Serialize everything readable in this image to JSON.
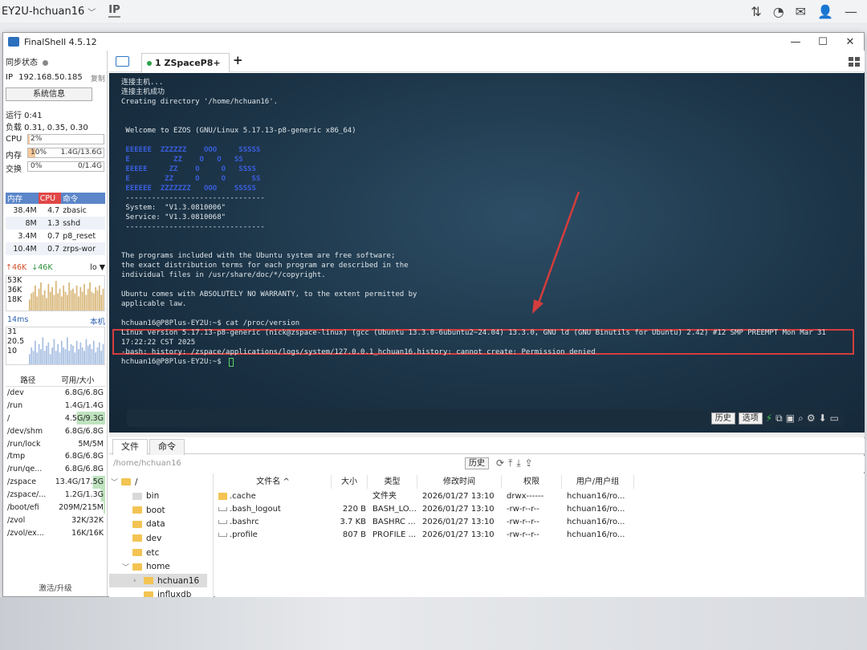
{
  "hostbar": {
    "title": "EY2U-hchuan16",
    "ip_label": "IP"
  },
  "window": {
    "title": "FinalShell 4.5.12",
    "controls": [
      "—",
      "☐",
      "✕"
    ]
  },
  "sidebar": {
    "sync_label": "同步状态",
    "ip_label": "IP",
    "ip_value": "192.168.50.185",
    "copy_label": "复制",
    "sysinfo_button": "系统信息",
    "uptime": "运行 0:41",
    "load": "负载 0.31, 0.35, 0.30",
    "cpu": {
      "label": "CPU",
      "pct": "2%",
      "fill": 0.02
    },
    "mem": {
      "label": "内存",
      "pct": "10%",
      "amount": "1.4G/13.6G",
      "fill": 0.1
    },
    "swap": {
      "label": "交换",
      "pct": "0%",
      "amount": "0/1.4G",
      "fill": 0.0
    },
    "proc_headers": [
      "内存",
      "CPU",
      "命令"
    ],
    "processes": [
      {
        "mem": "38.4M",
        "cpu": "4.7",
        "cmd": "zbasic"
      },
      {
        "mem": "8M",
        "cpu": "1.3",
        "cmd": "sshd"
      },
      {
        "mem": "3.4M",
        "cpu": "0.7",
        "cmd": "p8_reset"
      },
      {
        "mem": "10.4M",
        "cpu": "0.7",
        "cmd": "zrps-wor"
      }
    ],
    "net": {
      "up": "↑46K",
      "down": "↓46K",
      "iface": "lo"
    },
    "net_scale": [
      "53K",
      "36K",
      "18K"
    ],
    "net_bars": [
      0.35,
      0.55,
      0.6,
      0.8,
      0.45,
      0.7,
      0.9,
      0.5,
      0.65,
      0.4,
      0.85,
      0.6,
      0.75,
      0.5,
      0.95,
      0.55,
      0.7,
      0.45,
      0.8,
      0.6,
      0.5,
      0.9,
      0.65,
      0.7,
      0.55,
      0.8,
      0.45,
      0.75,
      0.6,
      0.85,
      0.5,
      0.7,
      0.9,
      0.6,
      0.55,
      0.75,
      0.65,
      0.8,
      0.5,
      0.7
    ],
    "latency": {
      "ms": "14ms",
      "local": "本机"
    },
    "lat_scale": [
      "31",
      "20.5",
      "10"
    ],
    "lat_bars": [
      0.3,
      0.5,
      0.4,
      0.7,
      0.35,
      0.6,
      0.45,
      0.8,
      0.4,
      0.55,
      0.65,
      0.3,
      0.5,
      0.75,
      0.4,
      0.6,
      0.35,
      0.7,
      0.5,
      0.45,
      0.8,
      0.4,
      0.6,
      0.55,
      0.35,
      0.7,
      0.45,
      0.65,
      0.5,
      0.4,
      0.75,
      0.55,
      0.6,
      0.45,
      0.7,
      0.35,
      0.5,
      0.65,
      0.4,
      0.6
    ],
    "disk_headers": [
      "路径",
      "可用/大小"
    ],
    "disks": [
      {
        "path": "/dev",
        "amount": "6.8G/6.8G",
        "used": 0.0
      },
      {
        "path": "/run",
        "amount": "1.4G/1.4G",
        "used": 0.0
      },
      {
        "path": "/",
        "amount": "4.5G/9.3G",
        "used": 0.52
      },
      {
        "path": "/dev/shm",
        "amount": "6.8G/6.8G",
        "used": 0.0
      },
      {
        "path": "/run/lock",
        "amount": "5M/5M",
        "used": 0.0
      },
      {
        "path": "/tmp",
        "amount": "6.8G/6.8G",
        "used": 0.0
      },
      {
        "path": "/run/qe...",
        "amount": "6.8G/6.8G",
        "used": 0.0
      },
      {
        "path": "/zspace",
        "amount": "13.4G/17.5G",
        "used": 0.23
      },
      {
        "path": "/zspace/...",
        "amount": "1.2G/1.3G",
        "used": 0.08
      },
      {
        "path": "/boot/efi",
        "amount": "209M/215M",
        "used": 0.03
      },
      {
        "path": "/zvol",
        "amount": "32K/32K",
        "used": 0.0
      },
      {
        "path": "/zvol/ex...",
        "amount": "16K/16K",
        "used": 0.0
      }
    ],
    "activate_label": "激活/升级"
  },
  "tabs": {
    "session_tab": "1 ZSpaceP8+",
    "add_tab": "+"
  },
  "terminal": {
    "lines": [
      "连接主机...",
      "连接主机成功",
      "Creating directory '/home/hchuan16'.",
      "",
      "",
      " Welcome to EZOS (GNU/Linux 5.17.13-p8-generic x86_64)",
      "",
      " EEEEEE  ZZZZZZ    OOO     SSSSS",
      " E          ZZ    O   O   SS",
      " EEEEE     ZZ    O     O   SSSS",
      " E        ZZ     O     O      SS",
      " EEEEEE  ZZZZZZZ   OOO    SSSSS",
      " --------------------------------",
      " System:  \"V1.3.0810006\"",
      " Service: \"V1.3.0810068\"",
      " --------------------------------",
      "",
      "",
      "The programs included with the Ubuntu system are free software;",
      "the exact distribution terms for each program are described in the",
      "individual files in /usr/share/doc/*/copyright.",
      "",
      "Ubuntu comes with ABSOLUTELY NO WARRANTY, to the extent permitted by",
      "applicable law.",
      "",
      "hchuan16@P8Plus-EY2U:~$ cat /proc/version",
      "Linux version 5.17.13-p8-generic (nick@zspace-linux) (gcc (Ubuntu 13.3.0-6ubuntu2~24.04) 13.3.0, GNU ld (GNU Binutils for Ubuntu) 2.42) #12 SMP PREEMPT Mon Mar 31",
      "17:22:22 CST 2025",
      "-bash: history: /zspace/applications/logs/system/127.0.0.1_hchuan16.history: cannot create: Permission denied",
      "hchuan16@P8Plus-EY2U:~$ "
    ],
    "toolbar": {
      "history": "历史",
      "options": "选项"
    }
  },
  "file_panel": {
    "tabs": [
      "文件",
      "命令"
    ],
    "path": "/home/hchuan16",
    "history_button": "历史",
    "tree": [
      {
        "label": "/",
        "level": 0,
        "expanded": true,
        "icon": "folder"
      },
      {
        "label": "bin",
        "level": 1,
        "icon": "lock-folder"
      },
      {
        "label": "boot",
        "level": 1,
        "icon": "folder"
      },
      {
        "label": "data",
        "level": 1,
        "icon": "folder"
      },
      {
        "label": "dev",
        "level": 1,
        "icon": "folder"
      },
      {
        "label": "etc",
        "level": 1,
        "icon": "folder"
      },
      {
        "label": "home",
        "level": 1,
        "expanded": true,
        "icon": "folder"
      },
      {
        "label": "hchuan16",
        "level": 2,
        "selected": true,
        "icon": "folder"
      },
      {
        "label": "influxdb",
        "level": 2,
        "icon": "folder"
      }
    ],
    "columns": [
      "文件名 ^",
      "大小",
      "类型",
      "修改时间",
      "权限",
      "用户/用户组"
    ],
    "files": [
      {
        "name": ".cache",
        "size": "",
        "type": "文件夹",
        "mtime": "2026/01/27 13:10",
        "perm": "drwx------",
        "owner": "hchuan16/ro...",
        "kind": "dir"
      },
      {
        "name": ".bash_logout",
        "size": "220 B",
        "type": "BASH_LO...",
        "mtime": "2026/01/27 13:10",
        "perm": "-rw-r--r--",
        "owner": "hchuan16/ro...",
        "kind": "file"
      },
      {
        "name": ".bashrc",
        "size": "3.7 KB",
        "type": "BASHRC ...",
        "mtime": "2026/01/27 13:10",
        "perm": "-rw-r--r--",
        "owner": "hchuan16/ro...",
        "kind": "file"
      },
      {
        "name": ".profile",
        "size": "807 B",
        "type": "PROFILE ...",
        "mtime": "2026/01/27 13:10",
        "perm": "-rw-r--r--",
        "owner": "hchuan16/ro...",
        "kind": "file"
      }
    ]
  },
  "colors": {
    "highlight": "#d43d3d",
    "accent": "#2f77c6",
    "cpu_header": "#e04747",
    "proc_header": "#5b86c9"
  }
}
